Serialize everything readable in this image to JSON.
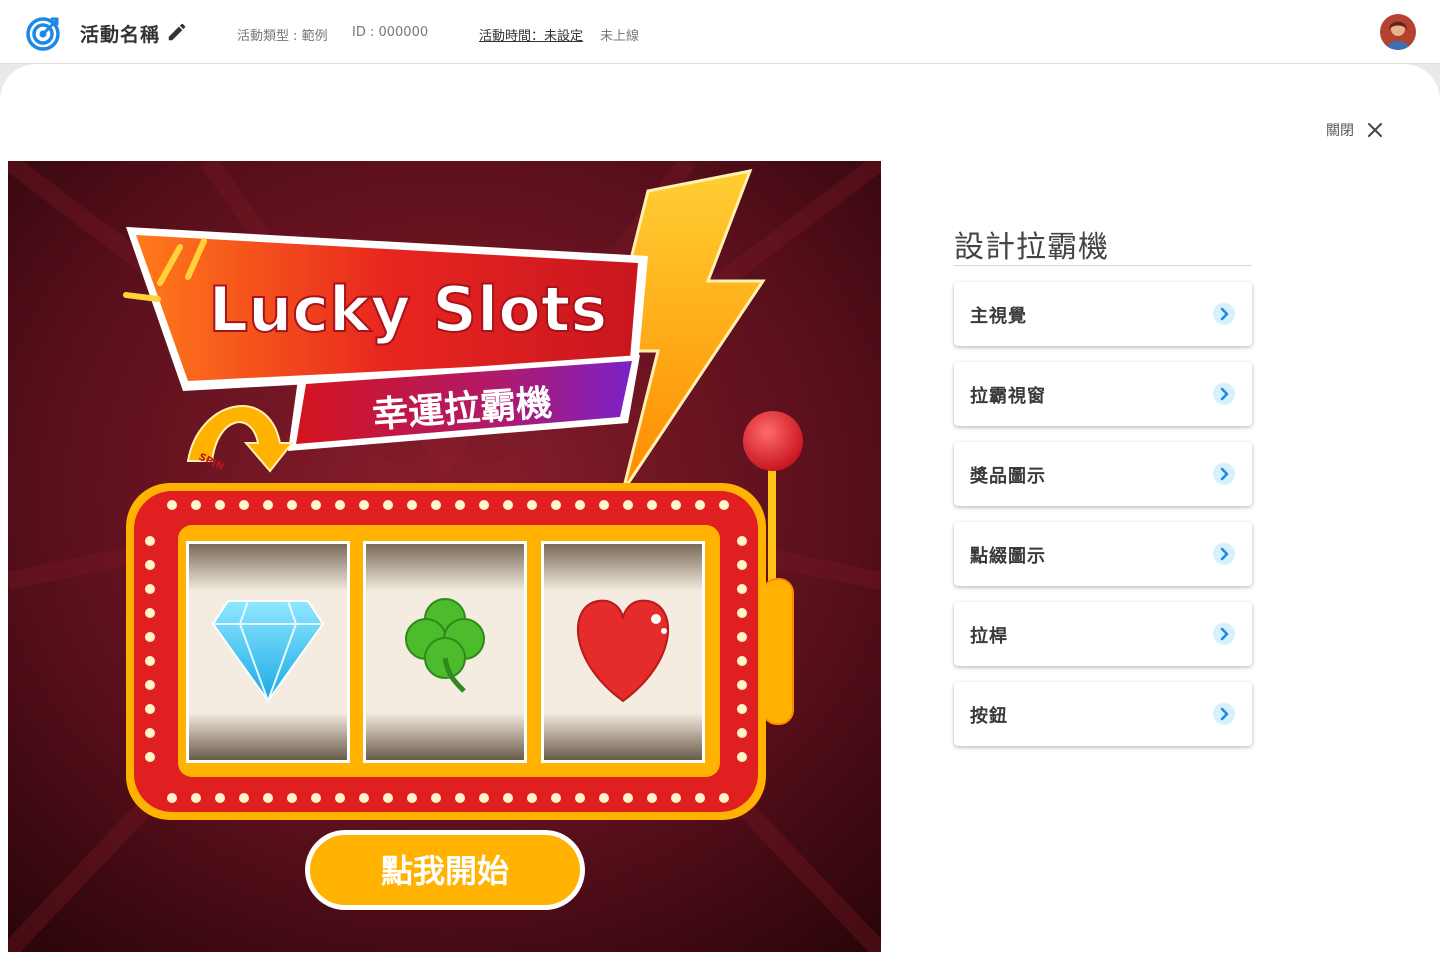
{
  "header": {
    "activity_name": "活動名稱",
    "activity_type": "活動類型 : 範例",
    "activity_id": "ID : 000000",
    "activity_time": "活動時間：未設定",
    "status": "未上線"
  },
  "panel": {
    "close_label": "關閉"
  },
  "preview": {
    "title_en": "Lucky Slots",
    "title_zh": "幸運拉霸機",
    "spin_label": "SPIN",
    "reels": [
      "diamond",
      "clover",
      "heart"
    ],
    "start_button": "點我開始"
  },
  "design": {
    "title": "設計拉霸機",
    "items": [
      {
        "label": "主視覺"
      },
      {
        "label": "拉霸視窗"
      },
      {
        "label": "獎品圖示"
      },
      {
        "label": "點綴圖示"
      },
      {
        "label": "拉桿"
      },
      {
        "label": "按鈕"
      }
    ]
  },
  "colors": {
    "accent": "#1e88e5",
    "chevron_bg": "#d6f1fb",
    "button_yellow": "#ffb300",
    "background_dark": "#5a0f1c"
  }
}
